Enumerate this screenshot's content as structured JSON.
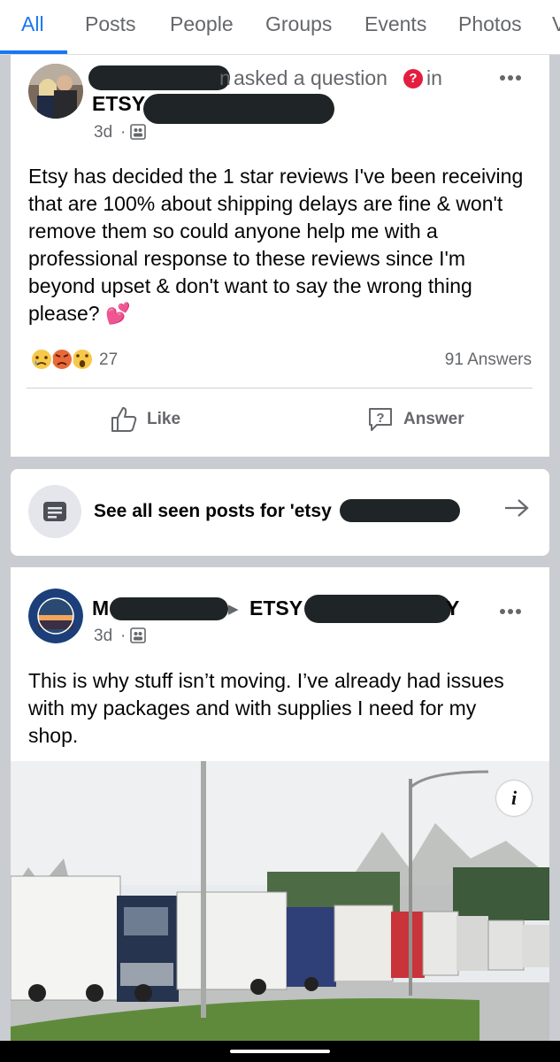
{
  "tabs": [
    {
      "label": "All",
      "active": true
    },
    {
      "label": "Posts",
      "active": false
    },
    {
      "label": "People",
      "active": false
    },
    {
      "label": "Groups",
      "active": false
    },
    {
      "label": "Events",
      "active": false
    },
    {
      "label": "Photos",
      "active": false
    },
    {
      "label": "V",
      "active": false
    }
  ],
  "post1": {
    "author_tail": "n",
    "action": "asked a question",
    "in_word": "in",
    "group": "ETSY",
    "time": "3d",
    "dot": "·",
    "text": "Etsy has decided the 1 star reviews I've been receiving that are 100% about shipping delays are fine & won't remove them so could anyone help me with a professional response to these reviews since I'm beyond upset & don't want to say the wrong thing please?",
    "heart_emoji": "💕",
    "reaction_count": "27",
    "answers": "91 Answers",
    "like_label": "Like",
    "answer_label": "Answer"
  },
  "see_all": {
    "label": "See all seen posts for 'etsy"
  },
  "post2": {
    "author_initial": "M",
    "arrow": "▶",
    "group": "ETSY",
    "group_tail": "Y",
    "time": "3d",
    "dot": "·",
    "text": "This is why stuff isn’t moving.  I’ve already had issues with my packages and with supplies I need for my shop.",
    "info_label": "i"
  },
  "colors": {
    "accent": "#1877f2",
    "secondary_text": "#65676b",
    "redaction": "#1f2427"
  },
  "icons": [
    "question-badge-icon",
    "group-privacy-icon",
    "more-options-icon",
    "like-thumb-icon",
    "answer-question-icon",
    "feed-list-icon",
    "arrow-right-icon",
    "info-icon",
    "sad-reaction-icon",
    "angry-reaction-icon",
    "wow-reaction-icon"
  ]
}
